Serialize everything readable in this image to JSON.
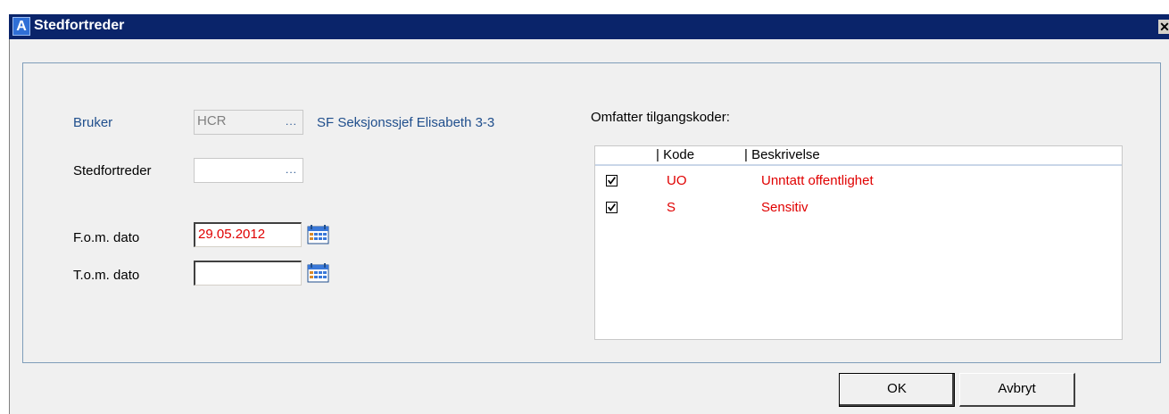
{
  "window": {
    "title": "Stedfortreder",
    "app_icon_letter": "A",
    "close_glyph": "✕"
  },
  "form": {
    "bruker_label": "Bruker",
    "bruker_value": "HCR",
    "bruker_name": "SF Seksjonssjef Elisabeth 3-3",
    "stedfortreder_label": "Stedfortreder",
    "stedfortreder_value": "",
    "fom_label": "F.o.m. dato",
    "fom_value": "29.05.2012",
    "tom_label": "T.o.m. dato",
    "tom_value": "",
    "lookup_dots": "..."
  },
  "access_codes": {
    "heading": "Omfatter tilgangskoder:",
    "columns": [
      "Kode",
      "Beskrivelse"
    ],
    "rows": [
      {
        "checked": true,
        "code": "UO",
        "description": "Unntatt offentlighet"
      },
      {
        "checked": true,
        "code": "S",
        "description": "Sensitiv"
      }
    ]
  },
  "buttons": {
    "ok": "OK",
    "cancel": "Avbryt"
  },
  "colors": {
    "titlebar": "#0a246a",
    "label_blue": "#1f4e8c",
    "value_red": "#e00000"
  }
}
